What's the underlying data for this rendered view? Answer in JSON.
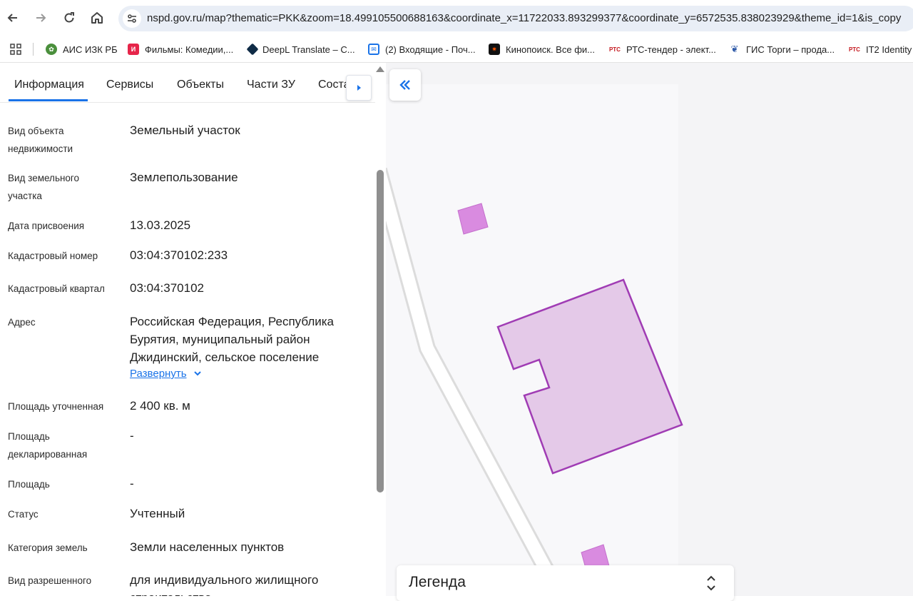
{
  "browser": {
    "url": "nspd.gov.ru/map?thematic=PKK&zoom=18.499105500688163&coordinate_x=11722033.893299377&coordinate_y=6572535.838023929&theme_id=1&is_copy",
    "bookmarks": [
      {
        "label": "АИС ИЗК РБ",
        "icon": "leaf-emblem-icon",
        "color": "#4a8f3c"
      },
      {
        "label": "Фильмы: Комедии,...",
        "icon": "ivi-icon",
        "color": "#e6254a"
      },
      {
        "label": "DeepL Translate – C...",
        "icon": "deepl-icon",
        "color": "#0f2b46"
      },
      {
        "label": "(2) Входящие - Поч...",
        "icon": "mail-icon",
        "color": "#1a73e8"
      },
      {
        "label": "Кинопоиск. Все фи...",
        "icon": "kinopoisk-icon",
        "color": "#f50"
      },
      {
        "label": "РТС-тендер - элект...",
        "icon": "rts-icon",
        "color": "#c4161c"
      },
      {
        "label": "ГИС Торги – прода...",
        "icon": "eagle-icon",
        "color": "#2f5aa8"
      },
      {
        "label": "IT2 Identity",
        "icon": "rts-icon",
        "color": "#c4161c"
      }
    ]
  },
  "panel": {
    "tabs": [
      "Информация",
      "Сервисы",
      "Объекты",
      "Части ЗУ",
      "Соста"
    ],
    "active_tab": 0,
    "rows": [
      {
        "label": "Вид объекта недвижимости",
        "value": "Земельный участок"
      },
      {
        "label": "Вид земельного участка",
        "value": "Землепользование"
      },
      {
        "label": "Дата присвоения",
        "value": "13.03.2025"
      },
      {
        "label": "Кадастровый номер",
        "value": "03:04:370102:233"
      },
      {
        "label": "Кадастровый квартал",
        "value": "03:04:370102"
      },
      {
        "label": "Адрес",
        "value": "Российская Федерация, Республика Бурятия, муниципальный район Джидинский, сельское поселение"
      },
      {
        "label": "Площадь уточненная",
        "value": "2 400 кв. м"
      },
      {
        "label": "Площадь декларированная",
        "value": "-"
      },
      {
        "label": "Площадь",
        "value": "-"
      },
      {
        "label": "Статус",
        "value": "Учтенный"
      },
      {
        "label": "Категория земель",
        "value": "Земли населенных пунктов"
      },
      {
        "label": "Вид разрешенного",
        "value": "для индивидуального жилищного строительства"
      }
    ],
    "expand_label": "Развернуть"
  },
  "map": {
    "legend_title": "Легенда",
    "parcel_fill": "#e4c9e8",
    "parcel_stroke": "#a03cb4",
    "building_fill": "#d98be0"
  }
}
